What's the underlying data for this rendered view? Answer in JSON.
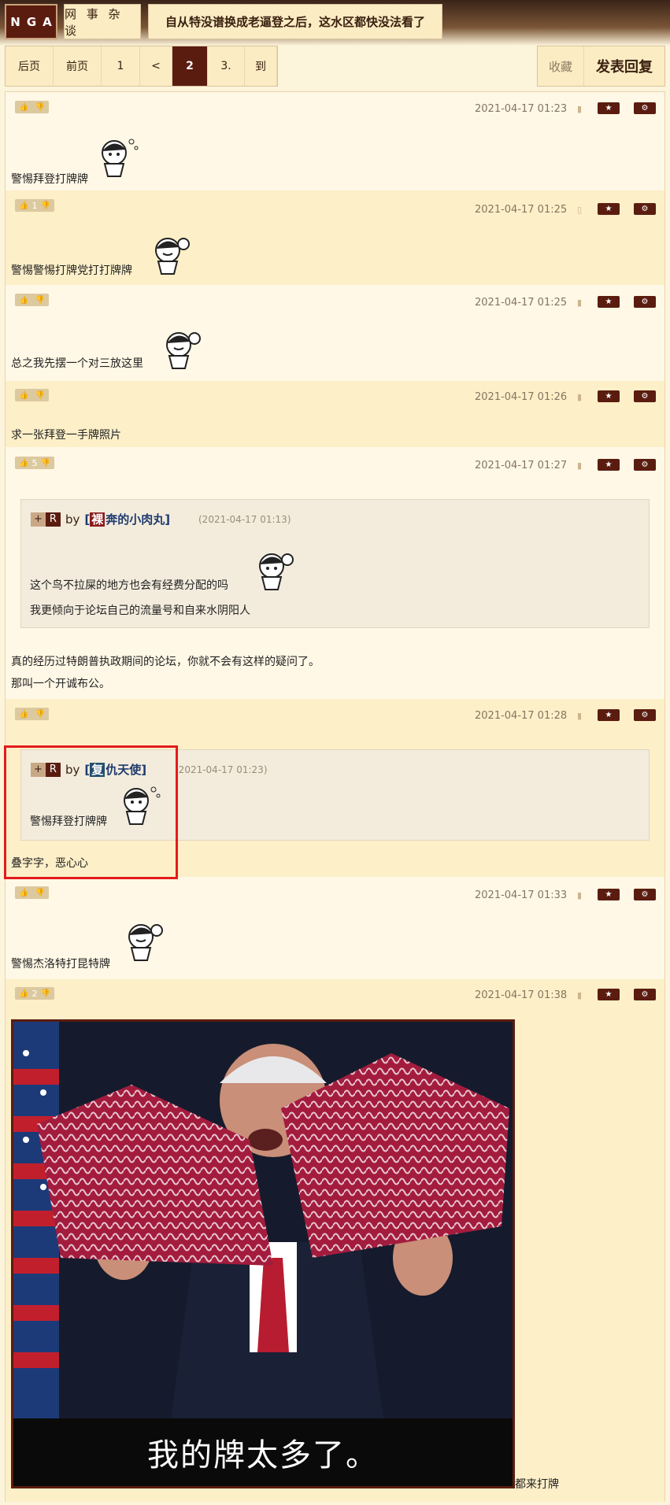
{
  "header": {
    "logo": "NGA",
    "board": "网 事 杂 谈",
    "thread_title": "自从特没谱换成老逼登之后，这水区都快没法看了"
  },
  "pager": {
    "items": [
      {
        "label": "后页",
        "w": 60
      },
      {
        "label": "前页",
        "w": 60
      },
      {
        "label": "1",
        "w": 48
      },
      {
        "label": "<",
        "w": 40
      },
      {
        "label": "2",
        "w": 44,
        "current": true
      },
      {
        "label": "3.",
        "w": 46
      },
      {
        "label": "到",
        "w": 40
      }
    ]
  },
  "actions": {
    "favorite": "收藏",
    "reply": "发表回复"
  },
  "posts": [
    {
      "time": "2021-04-17 01:23",
      "votes": "",
      "text": "警惕拜登打牌牌"
    },
    {
      "time": "2021-04-17 01:25",
      "votes": "1",
      "text": "警惕警惕打牌党打打牌牌"
    },
    {
      "time": "2021-04-17 01:25",
      "votes": "",
      "text": "总之我先摆一个对三放这里"
    },
    {
      "time": "2021-04-17 01:26",
      "votes": "",
      "text": "求一张拜登一手牌照片"
    },
    {
      "time": "2021-04-17 01:27",
      "votes": "5",
      "quote": {
        "plus": "+",
        "r": "R",
        "by": "by",
        "badge": "裸",
        "name": "奔的小肉丸",
        "time": "(2021-04-17 01:13)",
        "line1": "这个鸟不拉屎的地方也会有经费分配的吗",
        "line2": "我更倾向于论坛自己的流量号和自来水阴阳人"
      },
      "line1": "真的经历过特朗普执政期间的论坛，你就不会有这样的疑问了。",
      "line2": "那叫一个开诚布公。"
    },
    {
      "time": "2021-04-17 01:28",
      "votes": "",
      "quote": {
        "plus": "+",
        "r": "R",
        "by": "by",
        "badge": "复",
        "name": "仇天使",
        "time": "(2021-04-17 01:23)",
        "line1": "警惕拜登打牌牌"
      },
      "text": "叠字字，恶心心"
    },
    {
      "time": "2021-04-17 01:33",
      "votes": "",
      "text": "警惕杰洛特打昆特牌"
    },
    {
      "time": "2021-04-17 01:38",
      "votes": "2",
      "caption": "我的牌太多了。",
      "tail": "都来打牌"
    }
  ],
  "icons": {
    "star": "star-icon",
    "gear": "gear-icon",
    "up": "thumbs-up-icon",
    "down": "thumbs-down-icon",
    "device": "android-icon"
  },
  "colors": {
    "brand": "#5b1c10",
    "bg": "#fdf4dc",
    "alt_row": "#fdefc8",
    "highlight": "#e31b1b"
  }
}
